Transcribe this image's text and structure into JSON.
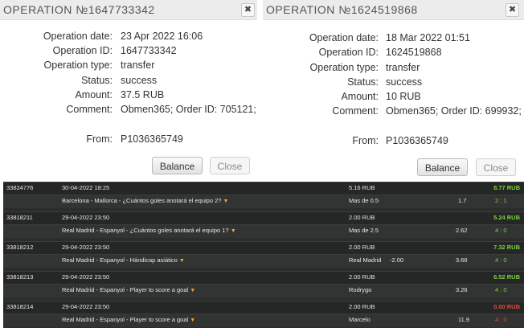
{
  "dialogs": [
    {
      "title": "OPERATION №1647733342",
      "fields": [
        {
          "label": "Operation date:",
          "value": "23 Apr 2022 16:06"
        },
        {
          "label": "Operation ID:",
          "value": "1647733342"
        },
        {
          "label": "Operation type:",
          "value": "transfer"
        },
        {
          "label": "Status:",
          "value": "success"
        },
        {
          "label": "Amount:",
          "value": "37.5 RUB"
        },
        {
          "label": "Comment:",
          "value": "Obmen365; Order ID: 705121;"
        }
      ],
      "from": {
        "label": "From:",
        "value": "P1036365749"
      },
      "balance_label": "Balance",
      "close_label": "Close",
      "close_icon": "✖"
    },
    {
      "title": "OPERATION №1624519868",
      "fields": [
        {
          "label": "Operation date:",
          "value": "18 Mar 2022 01:51"
        },
        {
          "label": "Operation ID:",
          "value": "1624519868"
        },
        {
          "label": "Operation type:",
          "value": "transfer"
        },
        {
          "label": "Status:",
          "value": "success"
        },
        {
          "label": "Amount:",
          "value": "10 RUB"
        },
        {
          "label": "Comment:",
          "value": "Obmen365; Order ID: 699932;"
        }
      ],
      "from": {
        "label": "From:",
        "value": "P1036365749"
      },
      "balance_label": "Balance",
      "close_label": "Close",
      "close_icon": "✖"
    }
  ],
  "colors": {
    "win": "#7bd13b",
    "loss": "#d8493f",
    "marker": "#f5a623"
  },
  "bets": [
    {
      "id": "33824776",
      "datetime": "30-04-2022 18:25",
      "stake": "5.16 RUB",
      "payout": "8.77 RUB",
      "payout_status": "win",
      "event": "Barcelona - Mallorca - ¿Cuántos goles anotará el equipo 2?",
      "selection": "Mas de 0.5",
      "handicap": "",
      "odds": "1.7",
      "score": "2 : 1"
    },
    {
      "id": "33818211",
      "datetime": "29-04-2022 23:50",
      "stake": "2.00 RUB",
      "payout": "5.24 RUB",
      "payout_status": "win",
      "event": "Real Madrid - Espanyol - ¿Cuántos goles anotará el equipo 1?",
      "selection": "Mas de 2.5",
      "handicap": "",
      "odds": "2.62",
      "score": "4 : 0"
    },
    {
      "id": "33818212",
      "datetime": "29-04-2022 23:50",
      "stake": "2.00 RUB",
      "payout": "7.32 RUB",
      "payout_status": "win",
      "event": "Real Madrid - Espanyol - Hándicap asiático",
      "selection": "Real Madrid",
      "handicap": "-2.00",
      "odds": "3.66",
      "score": "4 : 0"
    },
    {
      "id": "33818213",
      "datetime": "29-04-2022 23:50",
      "stake": "2.00 RUB",
      "payout": "6.52 RUB",
      "payout_status": "win",
      "event": "Real Madrid - Espanyol - Player to score a goal",
      "selection": "Rodrygo",
      "handicap": "",
      "odds": "3.26",
      "score": "4 : 0"
    },
    {
      "id": "33818214",
      "datetime": "29-04-2022 23:50",
      "stake": "2.00 RUB",
      "payout": "0.00 RUB",
      "payout_status": "loss",
      "event": "Real Madrid - Espanyol - Player to score a goal",
      "selection": "Marcelo",
      "handicap": "",
      "odds": "11.9",
      "score": "4 : 0"
    }
  ]
}
